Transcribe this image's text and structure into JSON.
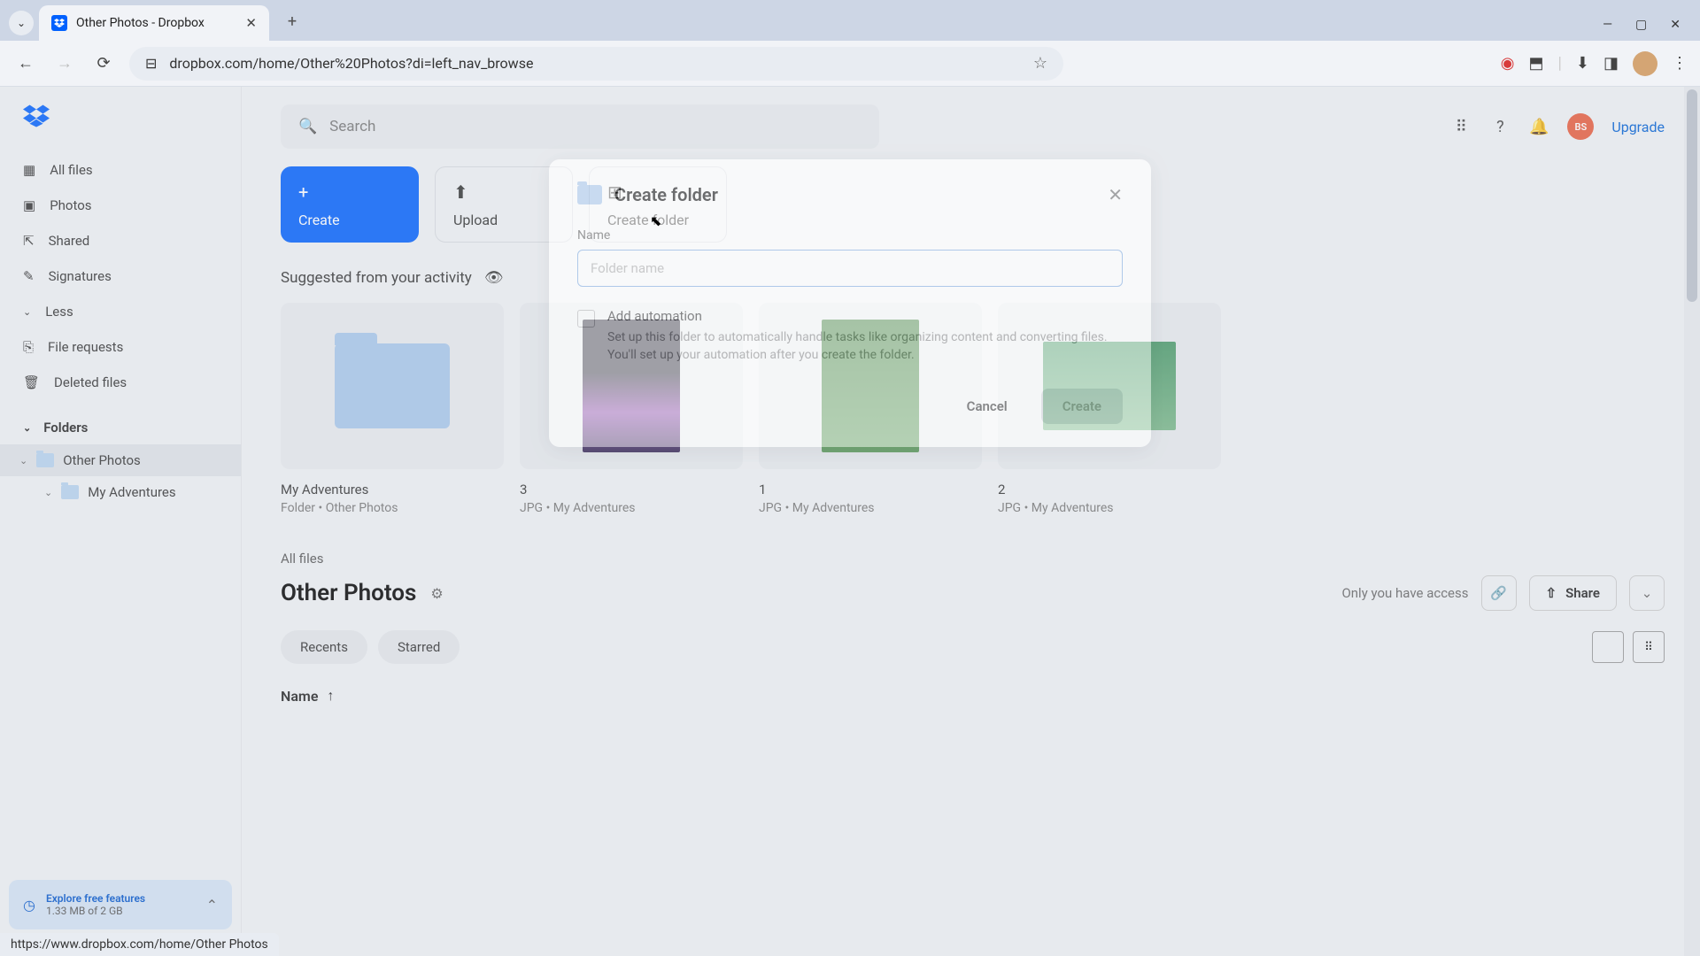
{
  "browser": {
    "tab_title": "Other Photos - Dropbox",
    "url": "dropbox.com/home/Other%20Photos?di=left_nav_browse",
    "status_url": "https://www.dropbox.com/home/Other Photos"
  },
  "sidebar": {
    "items": [
      {
        "label": "All files",
        "icon": "grid"
      },
      {
        "label": "Photos",
        "icon": "image"
      },
      {
        "label": "Shared",
        "icon": "share"
      },
      {
        "label": "Signatures",
        "icon": "pen"
      },
      {
        "label": "Less",
        "icon": "chev"
      },
      {
        "label": "File requests",
        "icon": "file"
      },
      {
        "label": "Deleted files",
        "icon": "trash"
      }
    ],
    "folders_header": "Folders",
    "folders": [
      {
        "label": "Other Photos",
        "selected": true
      },
      {
        "label": "My Adventures",
        "child": true
      }
    ],
    "promo": {
      "title": "Explore free features",
      "sub": "1.33 MB of 2 GB"
    }
  },
  "header": {
    "search_placeholder": "Search",
    "avatar_initials": "BS",
    "upgrade": "Upgrade"
  },
  "actions": {
    "create": "Create",
    "upload": "Upload",
    "create_folder": "Create folder"
  },
  "suggested": {
    "header": "Suggested from your activity",
    "cards": [
      {
        "title": "My Adventures",
        "sub": "Folder • Other Photos",
        "type": "folder"
      },
      {
        "title": "3",
        "sub": "JPG • My Adventures",
        "type": "p1"
      },
      {
        "title": "1",
        "sub": "JPG • My Adventures",
        "type": "p2"
      },
      {
        "title": "2",
        "sub": "JPG • My Adventures",
        "type": "p3"
      }
    ]
  },
  "files": {
    "breadcrumb": "All files",
    "title": "Other Photos",
    "access": "Only you have access",
    "share": "Share",
    "filters": [
      "Recents",
      "Starred"
    ],
    "column": "Name"
  },
  "modal": {
    "title": "Create folder",
    "name_label": "Name",
    "name_placeholder": "Folder name",
    "auto_label": "Add automation",
    "auto_desc": "Set up this folder to automatically handle tasks like organizing content and converting files. You'll set up your automation after you create the folder.",
    "cancel": "Cancel",
    "create": "Create"
  }
}
